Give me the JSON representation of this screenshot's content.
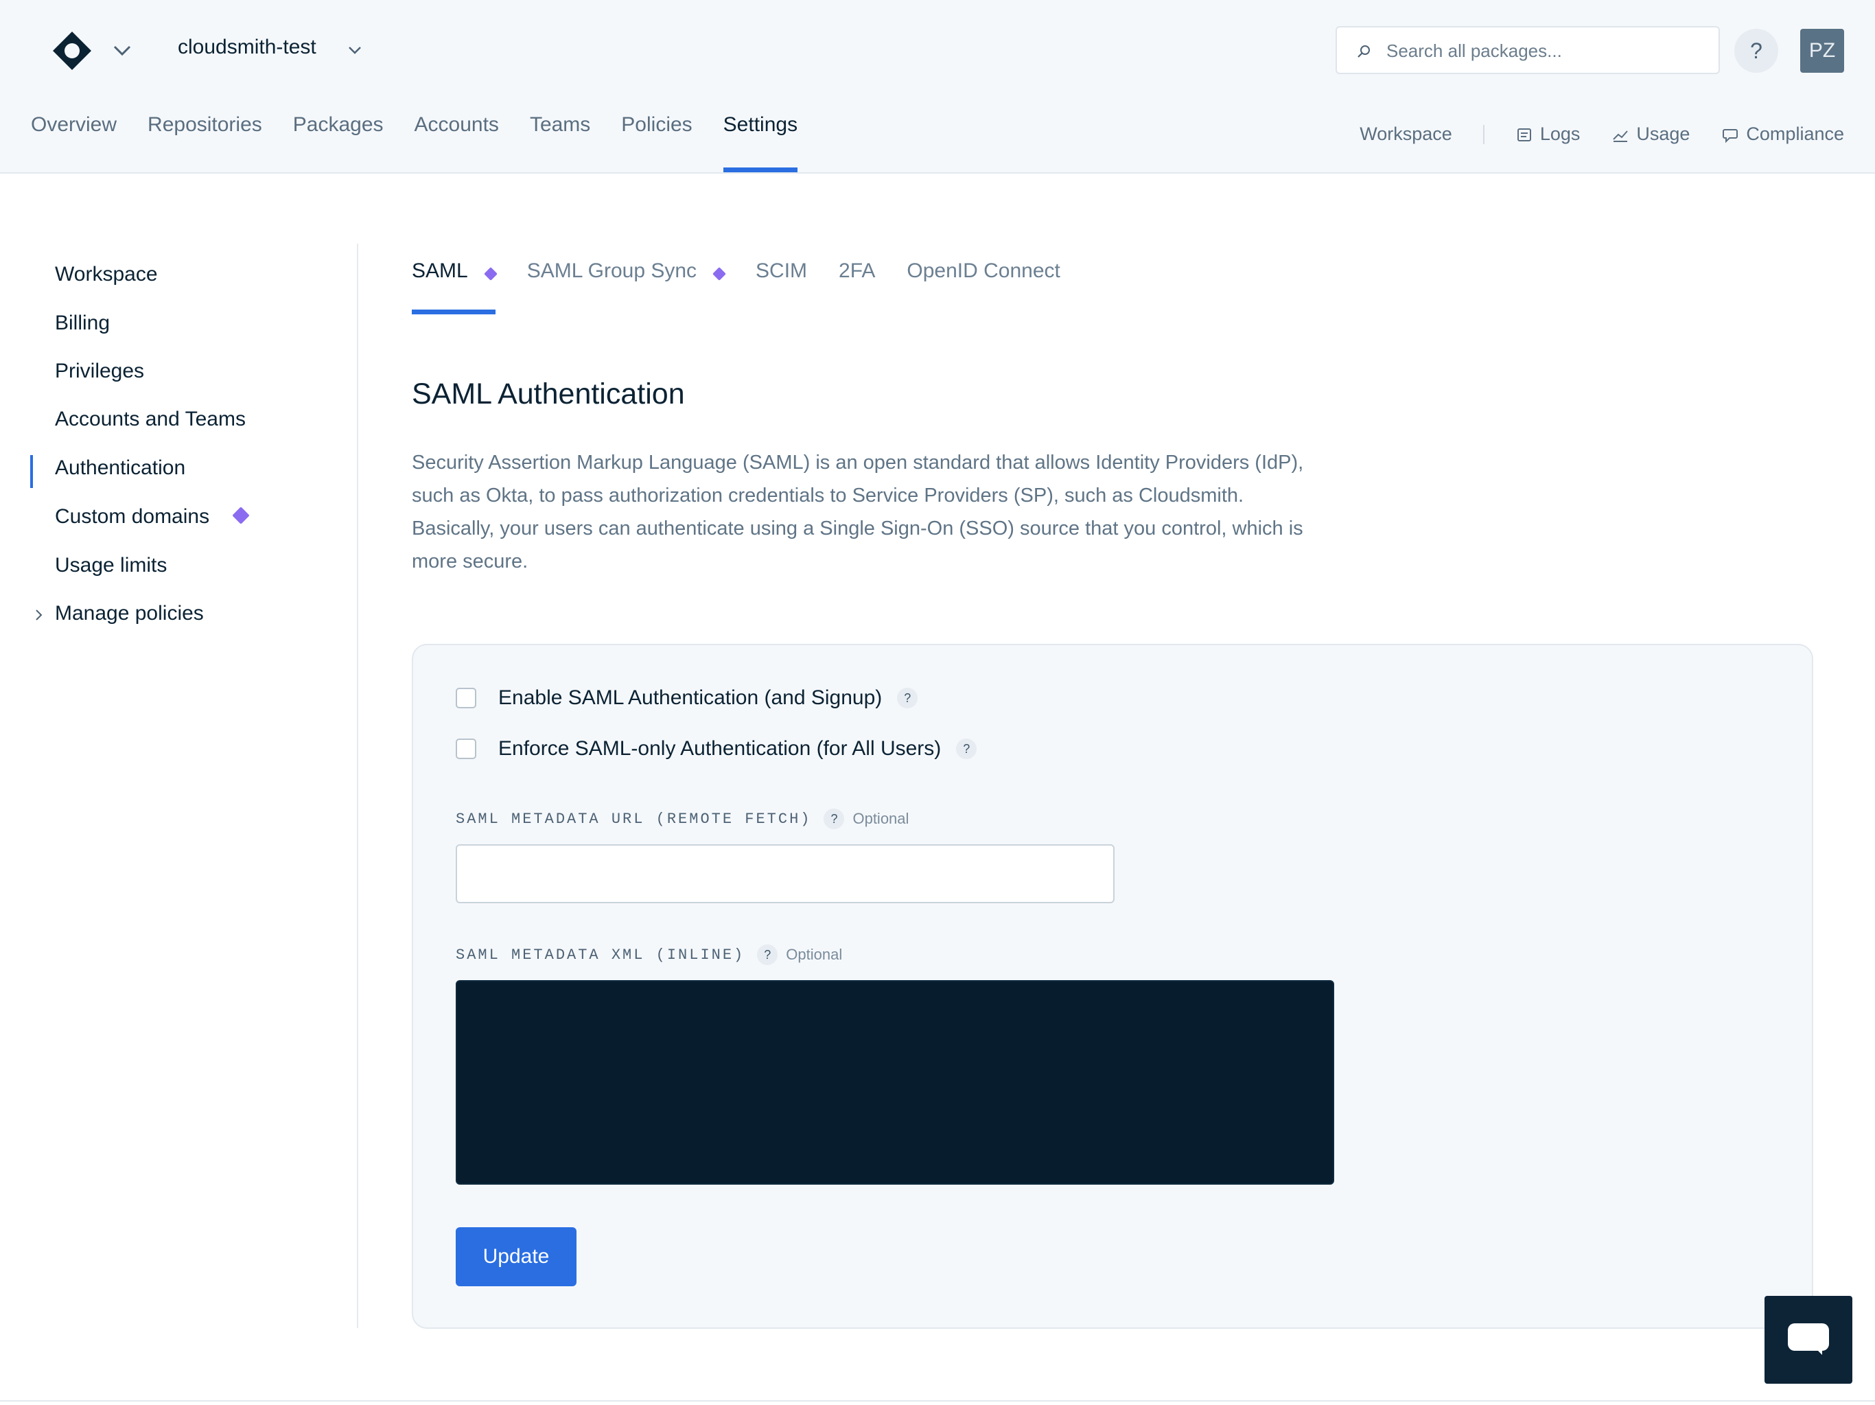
{
  "header": {
    "workspace_name": "cloudsmith-test",
    "search": {
      "placeholder": "Search all packages..."
    },
    "help_label": "?",
    "avatar_initials": "PZ"
  },
  "main_nav": {
    "items": [
      {
        "label": "Overview"
      },
      {
        "label": "Repositories"
      },
      {
        "label": "Packages"
      },
      {
        "label": "Accounts"
      },
      {
        "label": "Teams"
      },
      {
        "label": "Policies"
      },
      {
        "label": "Settings"
      }
    ],
    "active": "Settings"
  },
  "sub_nav": {
    "workspace": "Workspace",
    "logs": "Logs",
    "usage": "Usage",
    "compliance": "Compliance"
  },
  "sidebar": {
    "items": [
      {
        "label": "Workspace"
      },
      {
        "label": "Billing"
      },
      {
        "label": "Privileges"
      },
      {
        "label": "Accounts and Teams"
      },
      {
        "label": "Authentication"
      },
      {
        "label": "Custom domains"
      },
      {
        "label": "Usage limits"
      },
      {
        "label": "Manage policies"
      }
    ],
    "active": "Authentication"
  },
  "tabs": {
    "items": [
      {
        "label": "SAML"
      },
      {
        "label": "SAML Group Sync"
      },
      {
        "label": "SCIM"
      },
      {
        "label": "2FA"
      },
      {
        "label": "OpenID Connect"
      }
    ],
    "active": "SAML"
  },
  "content": {
    "title": "SAML Authentication",
    "description": "Security Assertion Markup Language (SAML) is an open standard that allows Identity Providers (IdP), such as Okta, to pass authorization credentials to Service Providers (SP), such as Cloudsmith. Basically, your users can authenticate using a Single Sign-On (SSO) source that you control, which is more secure."
  },
  "form": {
    "enable_saml": {
      "label": "Enable SAML Authentication (and Signup)",
      "checked": false
    },
    "enforce_saml": {
      "label": "Enforce SAML-only Authentication (for All Users)",
      "checked": false
    },
    "metadata_url": {
      "label": "SAML METADATA URL (REMOTE FETCH)",
      "optional": "Optional",
      "value": ""
    },
    "metadata_xml": {
      "label": "SAML METADATA XML (INLINE)",
      "optional": "Optional",
      "value": ""
    },
    "help_badge": "?",
    "submit_label": "Update"
  },
  "colors": {
    "accent": "#2a6ee2",
    "premium_diamond": "#8b6cf0",
    "text_primary": "#0b2233",
    "text_muted": "#5f7486",
    "header_bg": "#f5f8fb",
    "editor_bg": "#071d2e"
  }
}
